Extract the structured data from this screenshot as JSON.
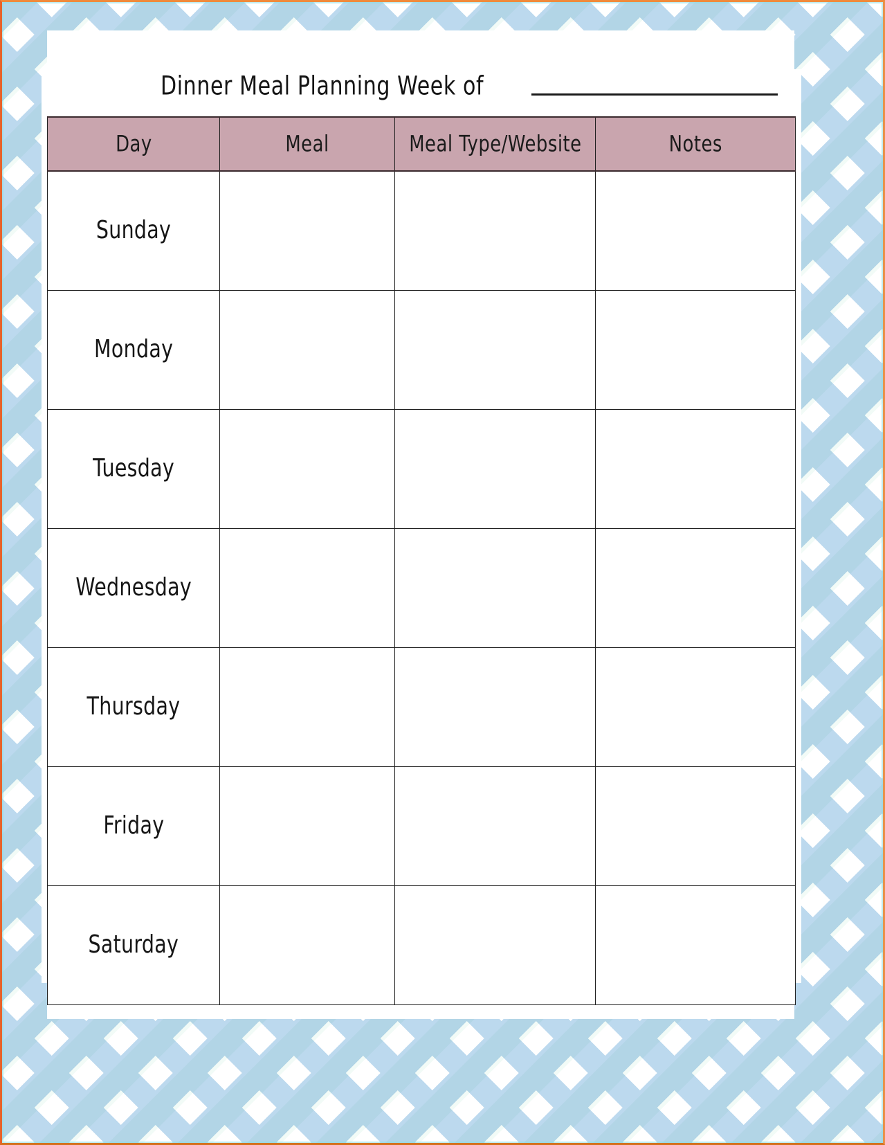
{
  "document": {
    "title": "Dinner Meal Planning Week of",
    "week_of_value": "",
    "week_of_blank": true
  },
  "theme": {
    "border_pattern": "chevron",
    "chevron_blue": "#bcd9ee",
    "chevron_white": "#ffffff",
    "header_mauve": "#c9a5ae",
    "paper_white": "#ffffff",
    "ink": "#1a1a1a",
    "edge_fringe_orange": "#e8622a"
  },
  "table": {
    "columns": [
      {
        "key": "day",
        "label": "Day"
      },
      {
        "key": "meal",
        "label": "Meal"
      },
      {
        "key": "type",
        "label": "Meal Type/Website"
      },
      {
        "key": "notes",
        "label": "Notes"
      }
    ],
    "rows": [
      {
        "day": "Sunday",
        "meal": "",
        "type": "",
        "notes": ""
      },
      {
        "day": "Monday",
        "meal": "",
        "type": "",
        "notes": ""
      },
      {
        "day": "Tuesday",
        "meal": "",
        "type": "",
        "notes": ""
      },
      {
        "day": "Wednesday",
        "meal": "",
        "type": "",
        "notes": ""
      },
      {
        "day": "Thursday",
        "meal": "",
        "type": "",
        "notes": ""
      },
      {
        "day": "Friday",
        "meal": "",
        "type": "",
        "notes": ""
      },
      {
        "day": "Saturday",
        "meal": "",
        "type": "",
        "notes": ""
      }
    ]
  }
}
